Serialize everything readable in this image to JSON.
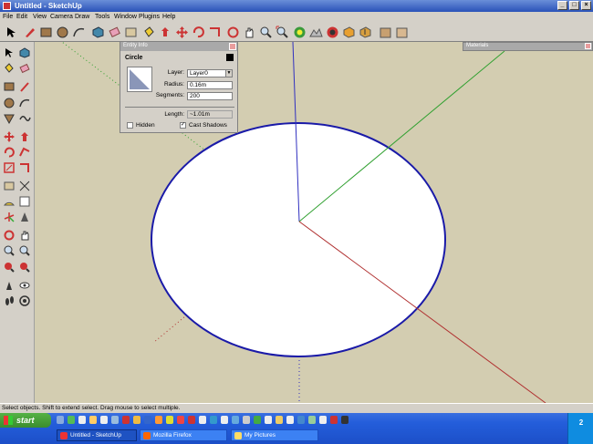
{
  "window": {
    "title": "Untitled - SketchUp",
    "minimize": "_",
    "maximize": "□",
    "close": "×"
  },
  "menu": [
    "File",
    "Edit",
    "View",
    "Camera",
    "Draw",
    "Tools",
    "Window",
    "Plugins",
    "Help"
  ],
  "entity_info": {
    "panel_title": "Entity Info",
    "type": "Circle",
    "layer_label": "Layer:",
    "layer_value": "Layer0",
    "radius_label": "Radius:",
    "radius_value": "0.16m",
    "segments_label": "Segments:",
    "segments_value": "200",
    "length_label": "Length:",
    "length_value": "~1.01m",
    "hidden_label": "Hidden",
    "cast_shadows_label": "Cast Shadows",
    "hidden_checked": false,
    "cast_shadows_checked": true,
    "check_mark": "✓"
  },
  "materials_panel": {
    "title": "Materials"
  },
  "viewport": {
    "background": "#d3cdb1",
    "circle_fill": "#ffffff",
    "circle_stroke": "#1a1aa8",
    "red_axis": "#b03030",
    "green_axis": "#30a030",
    "blue_axis": "#3030c0"
  },
  "status": "Select objects. Shift to extend select. Drag mouse to select multiple.",
  "taskbar": {
    "start": "start",
    "tasks": [
      {
        "label": "Untitled - SketchUp",
        "active": true
      },
      {
        "label": "Mozilla Firefox",
        "active": false
      },
      {
        "label": "My Pictures",
        "active": false
      }
    ],
    "clock": "2"
  }
}
